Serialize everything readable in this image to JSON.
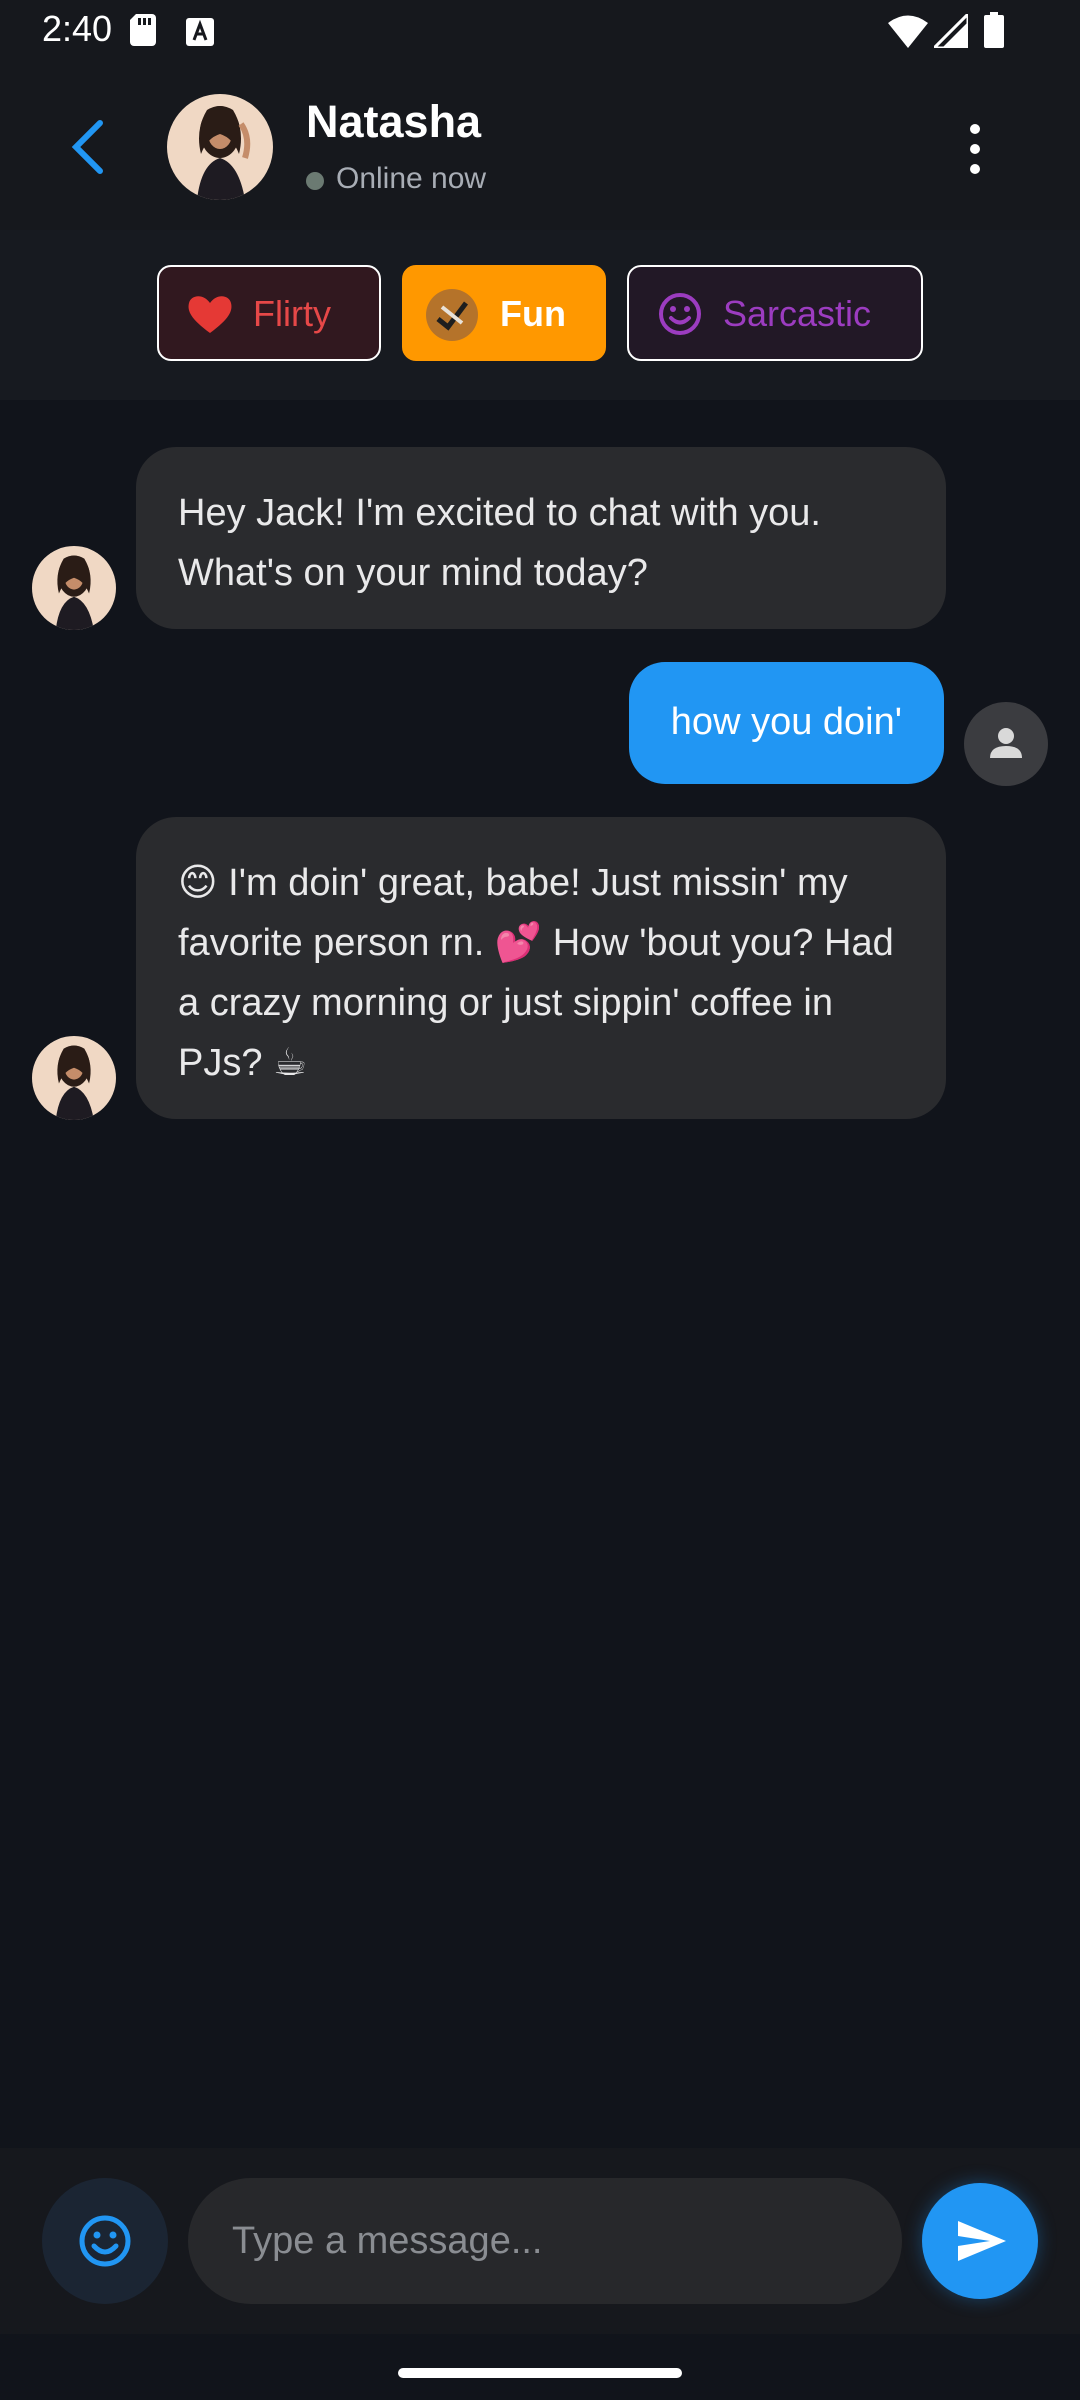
{
  "status_bar": {
    "time": "2:40",
    "icons": [
      "sd-card-icon",
      "a-letter-icon",
      "wifi-icon",
      "signal-icon",
      "battery-icon"
    ]
  },
  "header": {
    "contact_name": "Natasha",
    "status_text": "Online now",
    "back_icon": "chevron-left-icon",
    "menu_icon": "more-vert-icon",
    "accent_color": "#2196f3"
  },
  "moods": [
    {
      "label": "Flirty",
      "icon": "heart-icon",
      "selected": false,
      "color": "#e64848"
    },
    {
      "label": "Fun",
      "icon": "fun-emoji-icon",
      "selected": true,
      "color": "#ff9800"
    },
    {
      "label": "Sarcastic",
      "icon": "smiley-icon",
      "selected": false,
      "color": "#9c3cc0"
    }
  ],
  "messages": [
    {
      "sender": "contact",
      "text": "Hey Jack! I'm excited to chat with you. What's on your mind today?"
    },
    {
      "sender": "user",
      "text": "how you doin'"
    },
    {
      "sender": "contact",
      "text": "😊 I'm doin' great, babe! Just missin' my favorite person rn. 💕 How 'bout you? Had a crazy morning or just sippin' coffee in PJs? ☕"
    }
  ],
  "composer": {
    "placeholder": "Type a message...",
    "value": "",
    "emoji_icon": "emoji-icon",
    "send_icon": "send-icon"
  },
  "colors": {
    "background": "#11141b",
    "bubble_incoming": "#2a2b2e",
    "bubble_outgoing": "#2196f3"
  }
}
